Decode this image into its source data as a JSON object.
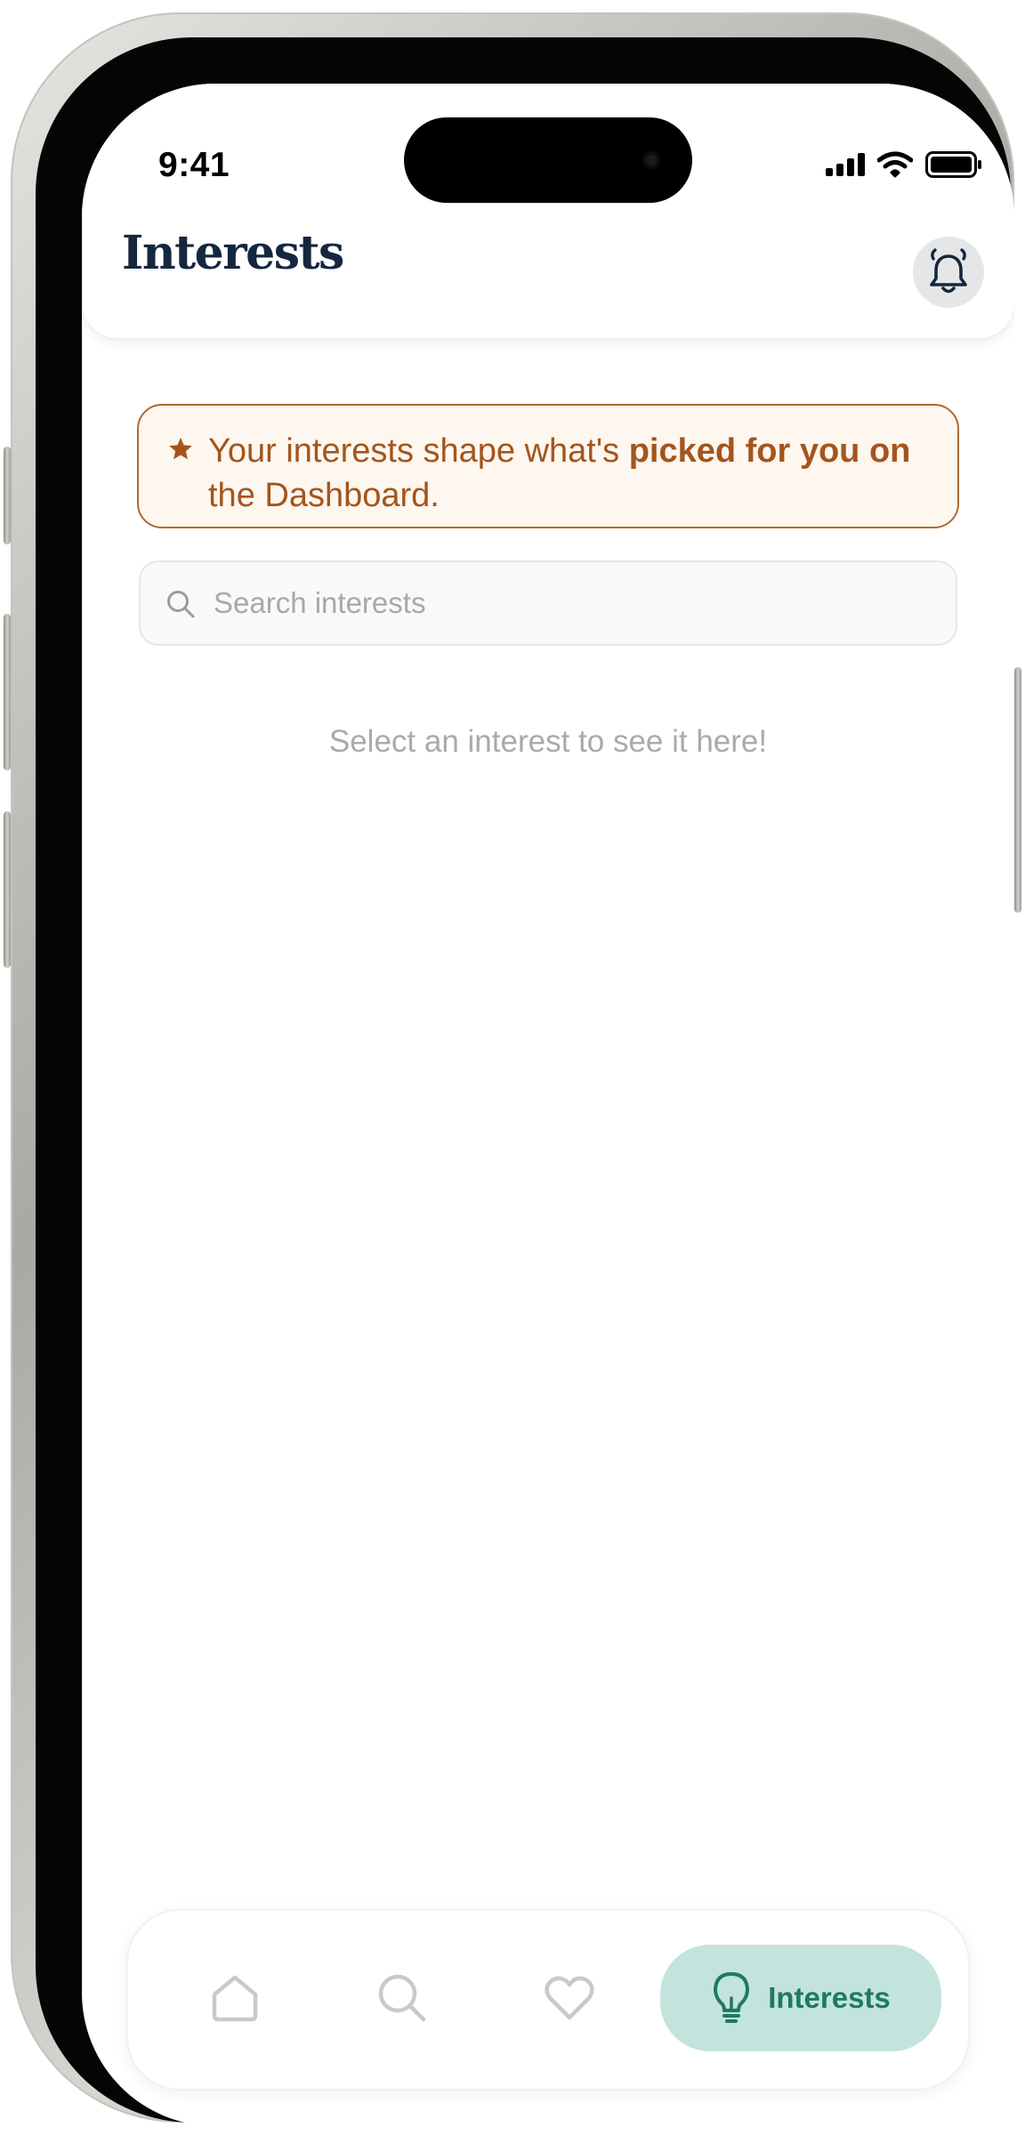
{
  "status_bar": {
    "time": "9:41"
  },
  "header": {
    "title": "Interests",
    "notifications_icon": "bell-icon"
  },
  "banner": {
    "icon": "star-icon",
    "text_before": "Your interests shape what's ",
    "text_bold": "picked for you on",
    "text_after": " the Dashboard.",
    "text_color": "#a4551c",
    "border_color": "#b06a2e",
    "background": "#fdf7ef"
  },
  "search": {
    "icon": "search-icon",
    "placeholder": "Search interests",
    "value": ""
  },
  "empty_state": {
    "text": "Select an interest to see it here!"
  },
  "tab_bar": {
    "items": [
      {
        "icon": "home-icon",
        "label": "",
        "active": false
      },
      {
        "icon": "search-icon",
        "label": "",
        "active": false
      },
      {
        "icon": "heart-icon",
        "label": "",
        "active": false
      },
      {
        "icon": "lightbulb-icon",
        "label": "Interests",
        "active": true
      }
    ],
    "active_background": "#c3e4dc",
    "active_color": "#1d7a63",
    "inactive_color": "#c8c9ca"
  }
}
